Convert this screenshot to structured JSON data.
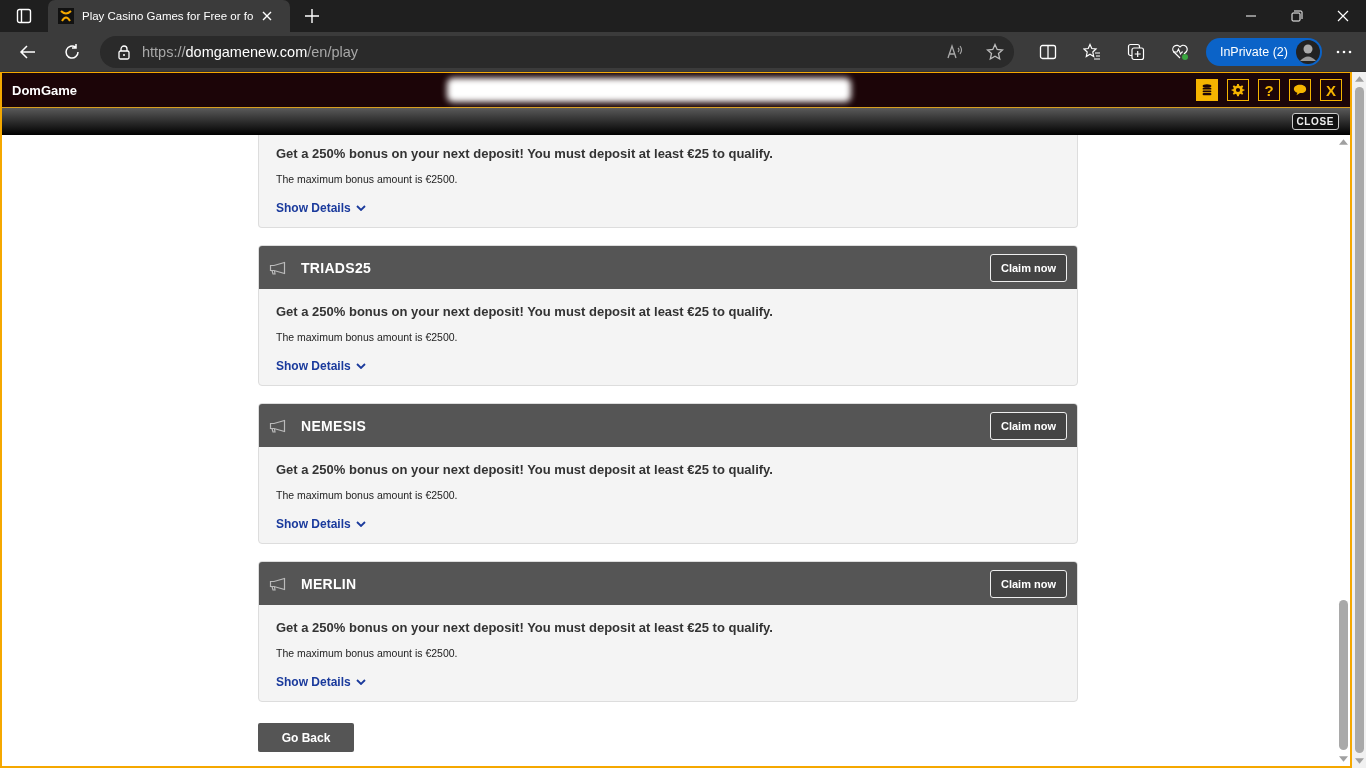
{
  "browser": {
    "tab_title": "Play Casino Games for Free or fo",
    "url": {
      "scheme": "https://",
      "host": "domgamenew.com",
      "path": "/en/play"
    },
    "profile_label": "InPrivate (2)"
  },
  "site": {
    "brand": "DomGame",
    "header_buttons": [
      {
        "kind": "coins",
        "selected": true
      },
      {
        "kind": "gear",
        "selected": false
      },
      {
        "kind": "text",
        "label": "?",
        "selected": false
      },
      {
        "kind": "chat",
        "selected": false
      },
      {
        "kind": "text",
        "label": "X",
        "selected": false
      }
    ],
    "close_label": "CLOSE"
  },
  "top_card": {
    "headline": "Get a 250% bonus on your next deposit! You must deposit at least €25 to qualify.",
    "note": "The maximum bonus amount is €2500.",
    "details_link": "Show Details"
  },
  "cards": [
    {
      "code": "TRIADS25",
      "claim": "Claim now",
      "headline": "Get a 250% bonus on your next deposit! You must deposit at least €25 to qualify.",
      "note": "The maximum bonus amount is €2500.",
      "details_link": "Show Details"
    },
    {
      "code": "NEMESIS",
      "claim": "Claim now",
      "headline": "Get a 250% bonus on your next deposit! You must deposit at least €25 to qualify.",
      "note": "The maximum bonus amount is €2500.",
      "details_link": "Show Details"
    },
    {
      "code": "MERLIN",
      "claim": "Claim now",
      "headline": "Get a 250% bonus on your next deposit! You must deposit at least €25 to qualify.",
      "note": "The maximum bonus amount is €2500.",
      "details_link": "Show Details"
    }
  ],
  "back_button": "Go Back"
}
